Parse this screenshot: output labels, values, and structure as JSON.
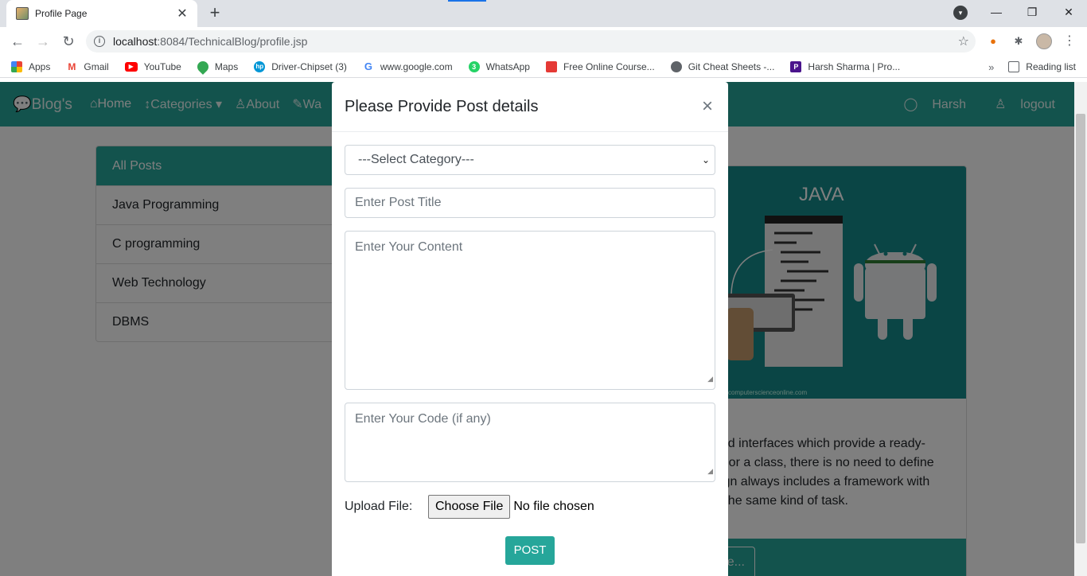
{
  "browser": {
    "tab_title": "Profile Page",
    "url_host": "localhost",
    "url_rest": ":8084/TechnicalBlog/profile.jsp",
    "bookmarks": [
      "Apps",
      "Gmail",
      "YouTube",
      "Maps",
      "Driver-Chipset (3)",
      "www.google.com",
      "WhatsApp",
      "Free Online Course...",
      "Git Cheat Sheets -...",
      "Harsh Sharma | Pro..."
    ],
    "reading_list": "Reading list"
  },
  "navbar": {
    "brand": "Blog's",
    "links": [
      "Home",
      "Categories",
      "About",
      "Wa"
    ],
    "user": "Harsh",
    "logout": "logout"
  },
  "sidebar": {
    "items": [
      "All Posts",
      "Java Programming",
      "C programming",
      "Web Technology",
      "DBMS"
    ]
  },
  "card": {
    "image_heading": "JAVA",
    "image_caption": "computerscienceonline.com",
    "text_lines": [
      "and interfaces which provide a ready-",
      "re or a class, there is no need to define",
      "sign always includes a framework with",
      "n the same kind of task."
    ],
    "button": "e..."
  },
  "modal": {
    "title": "Please Provide Post details",
    "close": "×",
    "category_selected": "---Select Category---",
    "title_placeholder": "Enter Post Title",
    "content_placeholder": "Enter Your Content",
    "code_placeholder": "Enter Your Code (if any)",
    "upload_label": "Upload File:",
    "choose_file": "Choose File",
    "no_file": "No file chosen",
    "post_button": "POST"
  },
  "colors": {
    "accent": "#26a69a",
    "image_bg": "#148a8a"
  }
}
